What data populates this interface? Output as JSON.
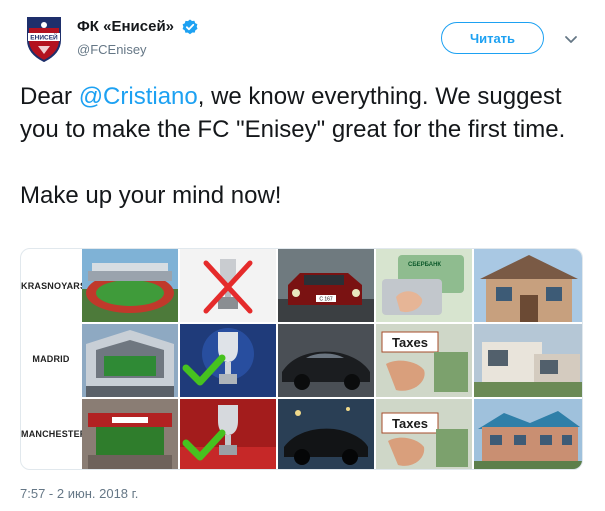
{
  "account": {
    "display_name": "ФК «Енисей»",
    "handle": "@FCEnisey",
    "verified": true,
    "logo_text": "ЕНИСЕЙ"
  },
  "follow_button": {
    "label": "Читать"
  },
  "tweet": {
    "text_before_mention": "Dear ",
    "mention": "@Cristiano",
    "text_after_mention": ", we know everything. We suggest you to make the FC \"Enisey\" great for the first time.",
    "second_line": "Make up your mind now!"
  },
  "media": {
    "rows": [
      {
        "label": "KRASNOYARSK",
        "cells": [
          "stadium-photo",
          "crossed-out-trophy-image",
          "old-car-photo",
          "bank-cards-photo",
          "small-house-photo"
        ]
      },
      {
        "label": "MADRID",
        "cells": [
          "stadium-photo",
          "trophy-check-image",
          "sports-car-photo",
          "taxes-sign-photo",
          "modern-villa-photo"
        ]
      },
      {
        "label": "MANCHESTER",
        "cells": [
          "stadium-photo",
          "trophy-check-image",
          "sports-car-photo",
          "taxes-sign-photo",
          "mansion-photo"
        ]
      }
    ],
    "taxes_text": "Taxes",
    "card_bank_text": "СБЕРБАНК",
    "plate_text": "C 167"
  },
  "timestamp": "7:57 - 2 июн. 2018 г.",
  "colors": {
    "accent": "#1da1f2",
    "muted": "#657786",
    "text": "#14171a"
  }
}
